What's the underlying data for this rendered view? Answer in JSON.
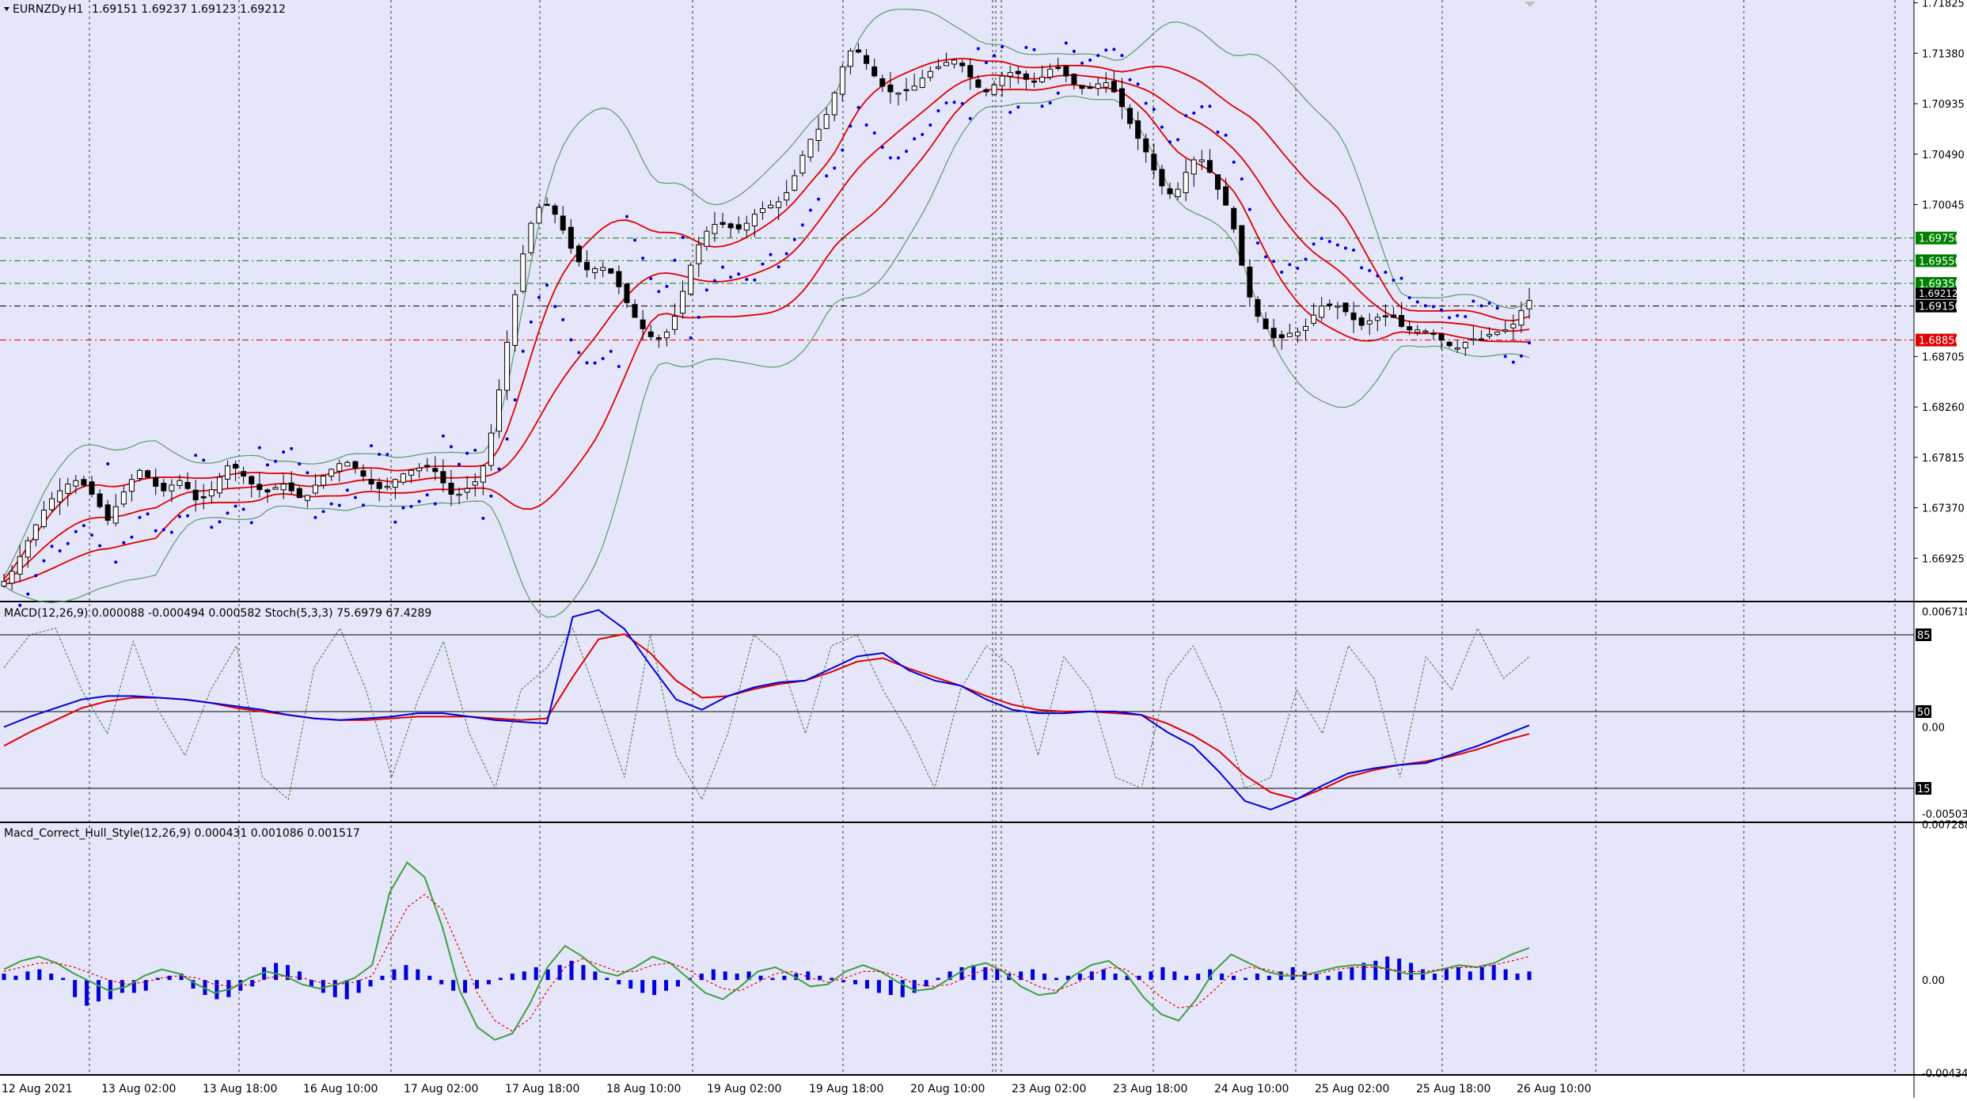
{
  "chart_data": [
    {
      "type": "candlestick",
      "title": "EURNZDy,H1  1.69151 1.69237 1.69123 1.69212",
      "symbol": "EURNZDy",
      "timeframe": "H1",
      "ohlc_label": "1.69151 1.69237 1.69123 1.69212",
      "ylim": [
        1.6655,
        1.7185
      ],
      "y_ticks": [
        "1.71825",
        "1.71380",
        "1.70935",
        "1.70490",
        "1.70045",
        "1.69550",
        "1.69150",
        "1.68705",
        "1.68260",
        "1.67815",
        "1.67370",
        "1.66925"
      ],
      "x_ticks": [
        "12 Aug 2021",
        "13 Aug 02:00",
        "13 Aug 18:00",
        "16 Aug 10:00",
        "17 Aug 02:00",
        "17 Aug 18:00",
        "18 Aug 10:00",
        "19 Aug 02:00",
        "19 Aug 18:00",
        "20 Aug 10:00",
        "23 Aug 02:00",
        "23 Aug 18:00",
        "24 Aug 10:00",
        "25 Aug 02:00",
        "25 Aug 18:00",
        "26 Aug 10:00"
      ],
      "horizontal_levels": [
        {
          "label": "1.69750",
          "value": 1.6975,
          "color": "#008000"
        },
        {
          "label": "1.69550",
          "value": 1.6955,
          "color": "#008000"
        },
        {
          "label": "1.69350",
          "value": 1.6935,
          "color": "#008000"
        },
        {
          "label": "1.69150",
          "value": 1.6915,
          "color": "#000000"
        },
        {
          "label": "1.68850",
          "value": 1.6885,
          "color": "#e00000"
        }
      ],
      "current_price_label": "1.69212",
      "closes": [
        1.6672,
        1.6681,
        1.6694,
        1.6708,
        1.6722,
        1.6735,
        1.6745,
        1.6752,
        1.6758,
        1.6761,
        1.6757,
        1.6749,
        1.6738,
        1.6726,
        1.6738,
        1.6751,
        1.6762,
        1.677,
        1.6764,
        1.6756,
        1.6752,
        1.6757,
        1.6761,
        1.6754,
        1.6744,
        1.6746,
        1.6753,
        1.6764,
        1.6774,
        1.6772,
        1.6765,
        1.6758,
        1.6753,
        1.6751,
        1.6755,
        1.6758,
        1.6752,
        1.6746,
        1.6748,
        1.6757,
        1.6765,
        1.6771,
        1.6776,
        1.6777,
        1.6772,
        1.6765,
        1.6758,
        1.6754,
        1.6756,
        1.6762,
        1.6767,
        1.677,
        1.6772,
        1.6774,
        1.6769,
        1.6759,
        1.6749,
        1.6749,
        1.6754,
        1.676,
        1.6774,
        1.6803,
        1.6841,
        1.6883,
        1.6925,
        1.6961,
        1.6988,
        1.7002,
        1.7004,
        1.6996,
        1.6982,
        1.6966,
        1.6954,
        1.6947,
        1.6948,
        1.6949,
        1.6944,
        1.6932,
        1.6918,
        1.6905,
        1.6895,
        1.6888,
        1.6887,
        1.6892,
        1.6906,
        1.6928,
        1.6951,
        1.6969,
        1.6981,
        1.6987,
        1.6987,
        1.6984,
        1.6983,
        1.6988,
        1.6996,
        1.7001,
        1.7004,
        1.7007,
        1.7015,
        1.703,
        1.7048,
        1.7062,
        1.7071,
        1.7084,
        1.7103,
        1.7126,
        1.714,
        1.7139,
        1.7129,
        1.7118,
        1.7109,
        1.7104,
        1.7103,
        1.7105,
        1.7109,
        1.7116,
        1.7122,
        1.7126,
        1.713,
        1.7132,
        1.7127,
        1.7117,
        1.7108,
        1.7104,
        1.711,
        1.7118,
        1.7121,
        1.712,
        1.7115,
        1.7113,
        1.7117,
        1.7124,
        1.7125,
        1.7118,
        1.7111,
        1.7107,
        1.7107,
        1.7111,
        1.7112,
        1.7104,
        1.7091,
        1.7076,
        1.7063,
        1.7051,
        1.7035,
        1.7021,
        1.7014,
        1.7018,
        1.7033,
        1.7044,
        1.7044,
        1.7033,
        1.7018,
        1.7004,
        1.6983,
        1.6951,
        1.6923,
        1.6906,
        1.6895,
        1.6887,
        1.6887,
        1.6891,
        1.6892,
        1.6897,
        1.6907,
        1.6915,
        1.6916,
        1.6915,
        1.691,
        1.6903,
        1.6898,
        1.6902,
        1.6905,
        1.6906,
        1.6905,
        1.6897,
        1.6894,
        1.6894,
        1.6893,
        1.6891,
        1.6885,
        1.688,
        1.6878,
        1.6883,
        1.6886,
        1.6886,
        1.689,
        1.6892,
        1.6894,
        1.6899,
        1.6911,
        1.692
      ]
    },
    {
      "type": "line",
      "title": "MACD(12,26,9) 0.000088 -0.000494 0.000582  Stoch(5,3,3) 75.6979 67.4289",
      "ylim": [
        -0.0055,
        0.0072
      ],
      "y_ticks": [
        "0.006718",
        "85",
        "50",
        "0.00",
        "15",
        "-0.005035"
      ],
      "levels": [
        85,
        50,
        15
      ],
      "series": [
        {
          "name": "MACD",
          "color": "#0000dd",
          "values": [
            0.0,
            0.0006,
            0.0011,
            0.0016,
            0.0018,
            0.0018,
            0.0017,
            0.0016,
            0.0014,
            0.0012,
            0.001,
            0.0007,
            0.0005,
            0.0004,
            0.0005,
            0.0006,
            0.0008,
            0.0008,
            0.0006,
            0.0004,
            0.0003,
            0.0002,
            0.0064,
            0.0068,
            0.0057,
            0.0036,
            0.0016,
            0.001,
            0.0018,
            0.0023,
            0.0026,
            0.0027,
            0.0034,
            0.0041,
            0.0043,
            0.0033,
            0.0027,
            0.0024,
            0.0016,
            0.001,
            0.0008,
            0.0008,
            0.0009,
            0.0009,
            0.0007,
            -0.0003,
            -0.0011,
            -0.0026,
            -0.0043,
            -0.0048,
            -0.0042,
            -0.0034,
            -0.0027,
            -0.0024,
            -0.0022,
            -0.0021,
            -0.0016,
            -0.0011,
            -0.0005,
            0.0001
          ]
        },
        {
          "name": "Signal",
          "color": "#e00000",
          "values": [
            -0.0011,
            -0.0003,
            0.0004,
            0.0011,
            0.0015,
            0.0017,
            0.0017,
            0.0016,
            0.0014,
            0.0011,
            0.0009,
            0.0007,
            0.0005,
            0.0004,
            0.0004,
            0.0005,
            0.0006,
            0.0006,
            0.0006,
            0.0005,
            0.0004,
            0.0005,
            0.0029,
            0.0051,
            0.0054,
            0.0043,
            0.0027,
            0.0017,
            0.0018,
            0.0022,
            0.0025,
            0.0027,
            0.0032,
            0.0038,
            0.004,
            0.0034,
            0.0029,
            0.0024,
            0.0018,
            0.0013,
            0.001,
            0.0009,
            0.0009,
            0.0008,
            0.0007,
            0.0002,
            -0.0005,
            -0.0014,
            -0.0028,
            -0.0038,
            -0.0042,
            -0.0036,
            -0.0029,
            -0.0025,
            -0.0022,
            -0.002,
            -0.0017,
            -0.0013,
            -0.0008,
            -0.0004
          ]
        },
        {
          "name": "Stoch",
          "color": "#5a8a5a",
          "values": [
            70,
            85,
            88,
            60,
            40,
            82,
            50,
            30,
            60,
            80,
            20,
            10,
            70,
            88,
            60,
            20,
            55,
            82,
            40,
            15,
            60,
            70,
            88,
            55,
            20,
            85,
            30,
            10,
            40,
            85,
            75,
            40,
            80,
            85,
            60,
            40,
            15,
            60,
            80,
            70,
            30,
            75,
            60,
            20,
            15,
            65,
            80,
            55,
            15,
            20,
            60,
            40,
            80,
            65,
            20,
            75,
            60,
            88,
            65,
            75
          ]
        }
      ]
    },
    {
      "type": "bar",
      "title": "Macd_Correct_Hull_Style(12,26,9) 0.000431 0.001086 0.001517",
      "ylim": [
        -0.0044,
        0.0073
      ],
      "y_ticks": [
        "0.007288",
        "0.00",
        "-0.004347"
      ],
      "series": [
        {
          "name": "Histogram",
          "color": "#0000dd",
          "values": [
            0.0003,
            0.0002,
            0.0004,
            0.0005,
            0.0003,
            0.0001,
            -0.0008,
            -0.0012,
            -0.001,
            -0.0009,
            -0.0006,
            -0.0006,
            -0.0005,
            0.0001,
            0.0002,
            0.0003,
            -0.0004,
            -0.0007,
            -0.0009,
            -0.0008,
            -0.0005,
            -0.0003,
            0.0006,
            0.0008,
            0.0007,
            0.0004,
            -0.0003,
            -0.0006,
            -0.0008,
            -0.0009,
            -0.0006,
            -0.0003,
            0.0002,
            0.0005,
            0.0007,
            0.0005,
            0.0002,
            -0.0002,
            -0.0005,
            -0.0006,
            -0.0004,
            -0.0002,
            0.0001,
            0.0003,
            0.0004,
            0.0006,
            0.0005,
            0.0007,
            0.0009,
            0.0007,
            0.0004,
            0.0001,
            -0.0002,
            -0.0004,
            -0.0006,
            -0.0007,
            -0.0005,
            -0.0003,
            0.0001,
            0.0003,
            0.0005,
            0.0004,
            0.0003,
            0.0004,
            0.0002,
            0.0001,
            0.0002,
            0.0003,
            0.0004,
            0.0002,
            0.0001,
            -0.0001,
            -0.0002,
            -0.0004,
            -0.0006,
            -0.0007,
            -0.0008,
            -0.0006,
            -0.0003,
            0.0001,
            0.0004,
            0.0006,
            0.0007,
            0.0006,
            0.0005,
            0.0003,
            0.0004,
            0.0005,
            0.0003,
            0.0001,
            0.0002,
            0.0003,
            0.0004,
            0.0005,
            0.0003,
            0.0002,
            0.0002,
            0.0004,
            0.0006,
            0.0004,
            0.0002,
            0.0003,
            0.0005,
            0.0003,
            0.0002,
            0.0001,
            0.0003,
            0.0002,
            0.0004,
            0.0006,
            0.0004,
            0.0003,
            0.0002,
            0.0004,
            0.0006,
            0.0008,
            0.0009,
            0.0011,
            0.001,
            0.0008,
            0.0005,
            0.0003,
            0.0005,
            0.0006,
            0.0004,
            0.0006,
            0.0007,
            0.0005,
            0.0003,
            0.0004
          ]
        },
        {
          "name": "Fast line",
          "color": "#3f9f3f",
          "values": [
            0.0005,
            0.0009,
            0.0011,
            0.0008,
            0.0003,
            -0.0001,
            -0.0005,
            -0.0003,
            0.0002,
            0.0005,
            0.0003,
            -0.0002,
            -0.0006,
            -0.0004,
            0.0001,
            0.0004,
            0.0002,
            -0.0002,
            -0.0004,
            -0.0002,
            0.0001,
            0.0007,
            0.0041,
            0.0055,
            0.0048,
            0.0025,
            -0.0005,
            -0.0022,
            -0.0028,
            -0.0025,
            -0.0011,
            0.0006,
            0.0016,
            0.0011,
            0.0004,
            0.0002,
            0.0006,
            0.0011,
            0.0008,
            0.0001,
            -0.0006,
            -0.0009,
            -0.0003,
            0.0004,
            0.0006,
            0.0002,
            -0.0003,
            -0.0002,
            0.0004,
            0.0007,
            0.0004,
            -0.0001,
            -0.0005,
            -0.0004,
            0.0001,
            0.0006,
            0.0008,
            0.0004,
            -0.0003,
            -0.0007,
            -0.0006,
            0.0002,
            0.0007,
            0.0009,
            0.0003,
            -0.0008,
            -0.0016,
            -0.0019,
            -0.0009,
            0.0004,
            0.0012,
            0.0008,
            0.0004,
            0.0002,
            0.0002,
            0.0004,
            0.0006,
            0.0007,
            0.0007,
            0.0005,
            0.0003,
            0.0003,
            0.0005,
            0.0007,
            0.0006,
            0.0008,
            0.0012,
            0.0015
          ]
        },
        {
          "name": "Signal line",
          "color": "#e00000",
          "values": [
            0.0004,
            0.0006,
            0.0008,
            0.0008,
            0.0006,
            0.0003,
            0.0,
            -0.0002,
            -0.0001,
            0.0001,
            0.0002,
            0.0001,
            -0.0002,
            -0.0003,
            -0.0002,
            0.0001,
            0.0002,
            0.0001,
            -0.0001,
            -0.0002,
            -0.0001,
            0.0002,
            0.0018,
            0.0034,
            0.004,
            0.0033,
            0.0014,
            -0.0006,
            -0.0019,
            -0.0024,
            -0.0018,
            -0.0005,
            0.0006,
            0.001,
            0.0007,
            0.0004,
            0.0004,
            0.0007,
            0.0008,
            0.0005,
            0.0,
            -0.0004,
            -0.0005,
            -0.0001,
            0.0003,
            0.0004,
            0.0001,
            -0.0001,
            0.0001,
            0.0004,
            0.0004,
            0.0002,
            -0.0002,
            -0.0003,
            -0.0002,
            0.0002,
            0.0005,
            0.0005,
            0.0001,
            -0.0003,
            -0.0005,
            -0.0002,
            0.0002,
            0.0006,
            0.0005,
            -0.0001,
            -0.0008,
            -0.0013,
            -0.0012,
            -0.0005,
            0.0003,
            0.0006,
            0.0005,
            0.0003,
            0.0002,
            0.0003,
            0.0005,
            0.0006,
            0.0006,
            0.0005,
            0.0004,
            0.0004,
            0.0005,
            0.0006,
            0.0006,
            0.0007,
            0.0009,
            0.0011
          ]
        }
      ]
    }
  ],
  "colors": {
    "plot_background": "#e6e6fa",
    "bull_candle": "#ffffff",
    "bear_candle": "#000000",
    "bollinger_band": "#5a9a6a",
    "envelope": "#e00000",
    "parabolic_sar": "#0000dd",
    "macd_line": "#0000dd",
    "signal_line": "#e00000",
    "stochastic": "#5a8a5a",
    "histogram": "#0000dd",
    "label_green": "#008000",
    "label_red": "#e00000",
    "label_black": "#000000"
  }
}
